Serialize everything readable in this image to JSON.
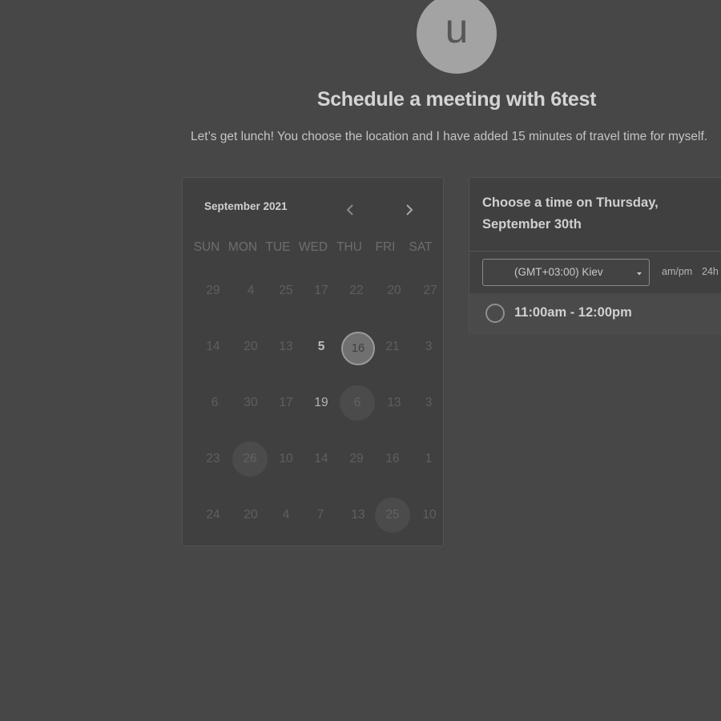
{
  "avatar": {
    "initial": "u"
  },
  "header": {
    "title": "Schedule a meeting with 6test",
    "subtitle": "Let’s get lunch! You choose the location and I have added 15 minutes of travel time for myself."
  },
  "calendar": {
    "month_label": "September 2021",
    "weekdays": [
      "SUN",
      "MON",
      "TUE",
      "WED",
      "THU",
      "FRI",
      "SAT"
    ],
    "weeks": [
      [
        "29",
        "4",
        "25",
        "17",
        "22",
        "20",
        "27"
      ],
      [
        "14",
        "20",
        "13",
        "5",
        "16",
        "21",
        "3"
      ],
      [
        "6",
        "30",
        "17",
        "19",
        "6",
        "13",
        "3"
      ],
      [
        "23",
        "26",
        "10",
        "14",
        "29",
        "16",
        "1"
      ],
      [
        "24",
        "20",
        "4",
        "7",
        "13",
        "25",
        "10"
      ]
    ]
  },
  "timepanel": {
    "title": "Choose a time on Thursday, September 30th",
    "timezone": "(GMT+03:00) Kiev",
    "format_ampm": "am/pm",
    "format_24h": "24h",
    "slots": [
      "11:00am - 12:00pm"
    ]
  }
}
